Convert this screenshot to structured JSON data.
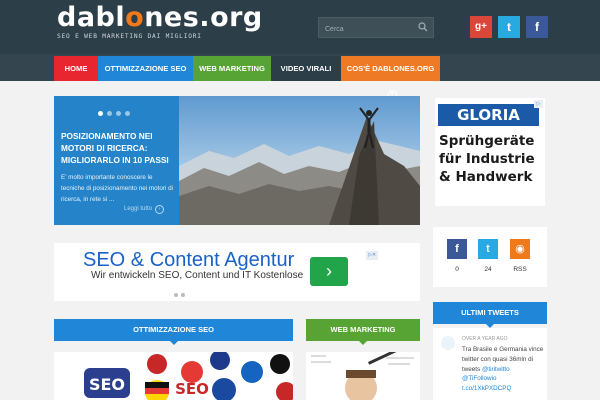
{
  "site": {
    "logo_prefix": "dabl",
    "logo_accent": "o",
    "logo_suffix": "nes.org",
    "tagline": "SEO E WEB MARKETING DAI MIGLIORI"
  },
  "search": {
    "placeholder": "Cerca"
  },
  "social_header": {
    "gplus": "g+",
    "twitter": "t",
    "facebook": "f"
  },
  "nav": {
    "items": [
      {
        "label": "HOME",
        "color": "#e8262f"
      },
      {
        "label": "OTTIMIZZAZIONE SEO",
        "color": "#1f86d8"
      },
      {
        "label": "WEB MARKETING",
        "color": "#57a333"
      },
      {
        "label": "VIDEO VIRALI",
        "color": "#2c3e48"
      },
      {
        "label": "COS'È DABLONES.ORG",
        "color": "#ef7a25"
      }
    ]
  },
  "slider": {
    "title": "POSIZIONAMENTO NEI MOTORI DI RICERCA: MIGLIORARLO IN 10 PASSI",
    "excerpt": "E' molto importante conoscere le tecniche di posizionamento nei motori di ricerca, in rete si ...",
    "read_more": "Leggi tutto",
    "dots": 4,
    "active_dot": 1
  },
  "ad_right": {
    "brand": "GLORIA",
    "text": "Sprühgeräte für Industrie & Handwerk"
  },
  "banner_ad": {
    "title": "SEO & Content Agentur",
    "subtitle": "Wir entwickeln SEO, Content und IT Kostenlose",
    "button": "›"
  },
  "social_counters": {
    "facebook": {
      "icon": "f",
      "count": "0"
    },
    "twitter": {
      "icon": "t",
      "count": "24"
    },
    "rss": {
      "icon": "◉",
      "label": "RSS"
    }
  },
  "sections": {
    "seo": "OTTIMIZZAZIONE SEO",
    "web": "WEB MARKETING",
    "tweets": "ULTIMI TWEETS"
  },
  "tweet": {
    "time": "OVER A YEAR AGO",
    "text": "Tra Brasile e Germania vince twitter con quasi 36mln di tweets",
    "link1": "@tiritwitto",
    "link2": "@TiFollowio",
    "link3": "t.co/1XkPXDCPQ"
  },
  "colors": {
    "header_bg": "#2c3e48",
    "accent_orange": "#f07a1a",
    "seo_blue": "#1f86d8",
    "web_green": "#57a333"
  }
}
